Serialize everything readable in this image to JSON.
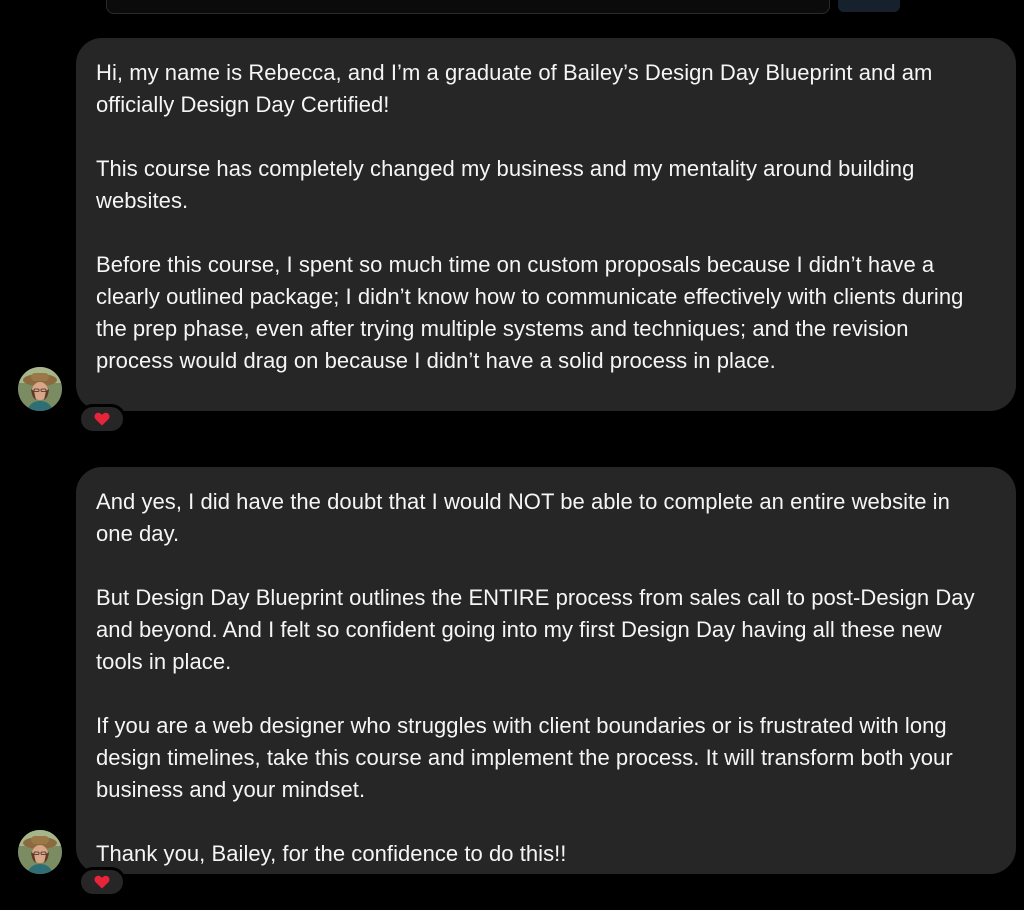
{
  "colors": {
    "background": "#000000",
    "bubble": "#262626",
    "text": "#f5f5f5",
    "heart": "#e8243b"
  },
  "messages": [
    {
      "paragraphs": [
        "Hi, my name is Rebecca, and I’m a graduate of Bailey’s Design Day Blueprint and am officially Design Day Certified!",
        "This course has completely changed my business and my mentality around building websites.",
        "Before this course, I spent so much time on custom proposals because I didn’t have a clearly outlined package; I didn’t know how to communicate effectively with clients during the prep phase, even after trying multiple systems and techniques; and the revision process would drag on because I didn’t have a solid process in place."
      ],
      "reaction": "heart-icon"
    },
    {
      "paragraphs": [
        "And yes, I did have the doubt that I would NOT be able to complete an entire website in one day.",
        "But Design Day Blueprint outlines the ENTIRE process from sales call to post-Design Day and beyond. And I felt so confident going into my first Design Day having all these new tools in place.",
        "If you are a web designer who struggles with client boundaries or is frustrated with long design timelines, take this course and implement the process. It will transform both your business and your mindset.",
        "Thank you, Bailey, for the confidence to do this!!"
      ],
      "reaction": "heart-icon"
    }
  ]
}
